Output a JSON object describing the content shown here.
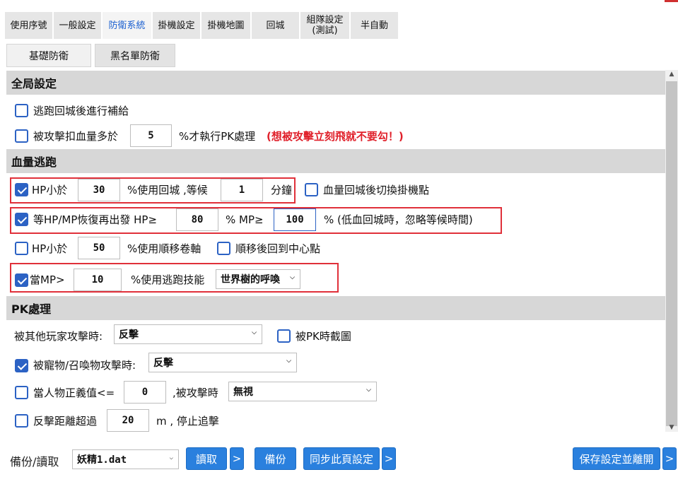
{
  "tabs": [
    {
      "label": "使用序號"
    },
    {
      "label": "一般設定"
    },
    {
      "label": "防衛系統"
    },
    {
      "label": "掛機設定"
    },
    {
      "label": "掛機地圖"
    },
    {
      "label": "回城"
    },
    {
      "label": "組隊設定(測試)",
      "line1": "組隊設定",
      "line2": "(測試)"
    },
    {
      "label": "半自動"
    }
  ],
  "active_tab": "防衛系統",
  "subtabs": [
    {
      "label": "基礎防衛"
    },
    {
      "label": "黑名單防衛"
    }
  ],
  "sections": {
    "global": "全局設定",
    "escape": "血量逃跑",
    "pk": "PK處理"
  },
  "global": {
    "refill_after_escape": {
      "label": "逃跑回城後進行補給",
      "checked": false
    },
    "hp_loss": {
      "label_before": "被攻擊扣血量多於",
      "value": "5",
      "label_after": "%才執行PK處理",
      "warning": "(想被攻擊立刻飛就不要勾！)",
      "checked": false
    }
  },
  "escape": {
    "hp_below_return": {
      "label": "HP小於",
      "value": "30",
      "middle": "%使用回城 ,等候",
      "wait": "1",
      "unit": "分鐘",
      "checked": true
    },
    "switch_spot": {
      "label": "血量回城後切換掛機點",
      "checked": false
    },
    "restore_depart": {
      "label": "等HP/MP恢復再出發 HP≥",
      "hp": "80",
      "middle": "% MP≥",
      "mp": "100",
      "after": "% (低血回城時，忽略等候時間)",
      "checked": true
    },
    "hp_below_teleport": {
      "label": "HP小於",
      "value": "50",
      "after": "%使用順移卷軸",
      "checked": false
    },
    "return_center": {
      "label": "順移後回到中心點",
      "checked": false
    },
    "mp_skill": {
      "label": "當MP>",
      "value": "10",
      "after": "%使用逃跑技能",
      "skill": "世界樹的呼喚",
      "checked": true
    }
  },
  "pk": {
    "attacked_by_player": {
      "label": "被其他玩家攻擊時:",
      "value": "反擊"
    },
    "screenshot": {
      "label": "被PK時截圖",
      "checked": false
    },
    "attacked_by_pet": {
      "label": "被寵物/召喚物攻擊時:",
      "value": "反擊",
      "checked": true
    },
    "justice": {
      "label": "當人物正義值<=",
      "value": "0",
      "middle": ",被攻擊時",
      "action": "無視",
      "checked": false
    },
    "distance": {
      "label": "反擊距離超過",
      "value": "20",
      "after": "m , 停止追擊",
      "checked": false
    }
  },
  "bottom": {
    "backup_label": "備份/讀取",
    "file": "妖精1.dat",
    "read": "讀取",
    "more": ">",
    "backup": "備份",
    "sync": "同步此頁設定",
    "save_exit": "保存設定並離開"
  },
  "colors": {
    "accent": "#2a80de",
    "check": "#2c62c4",
    "highlight": "#e0303a"
  }
}
